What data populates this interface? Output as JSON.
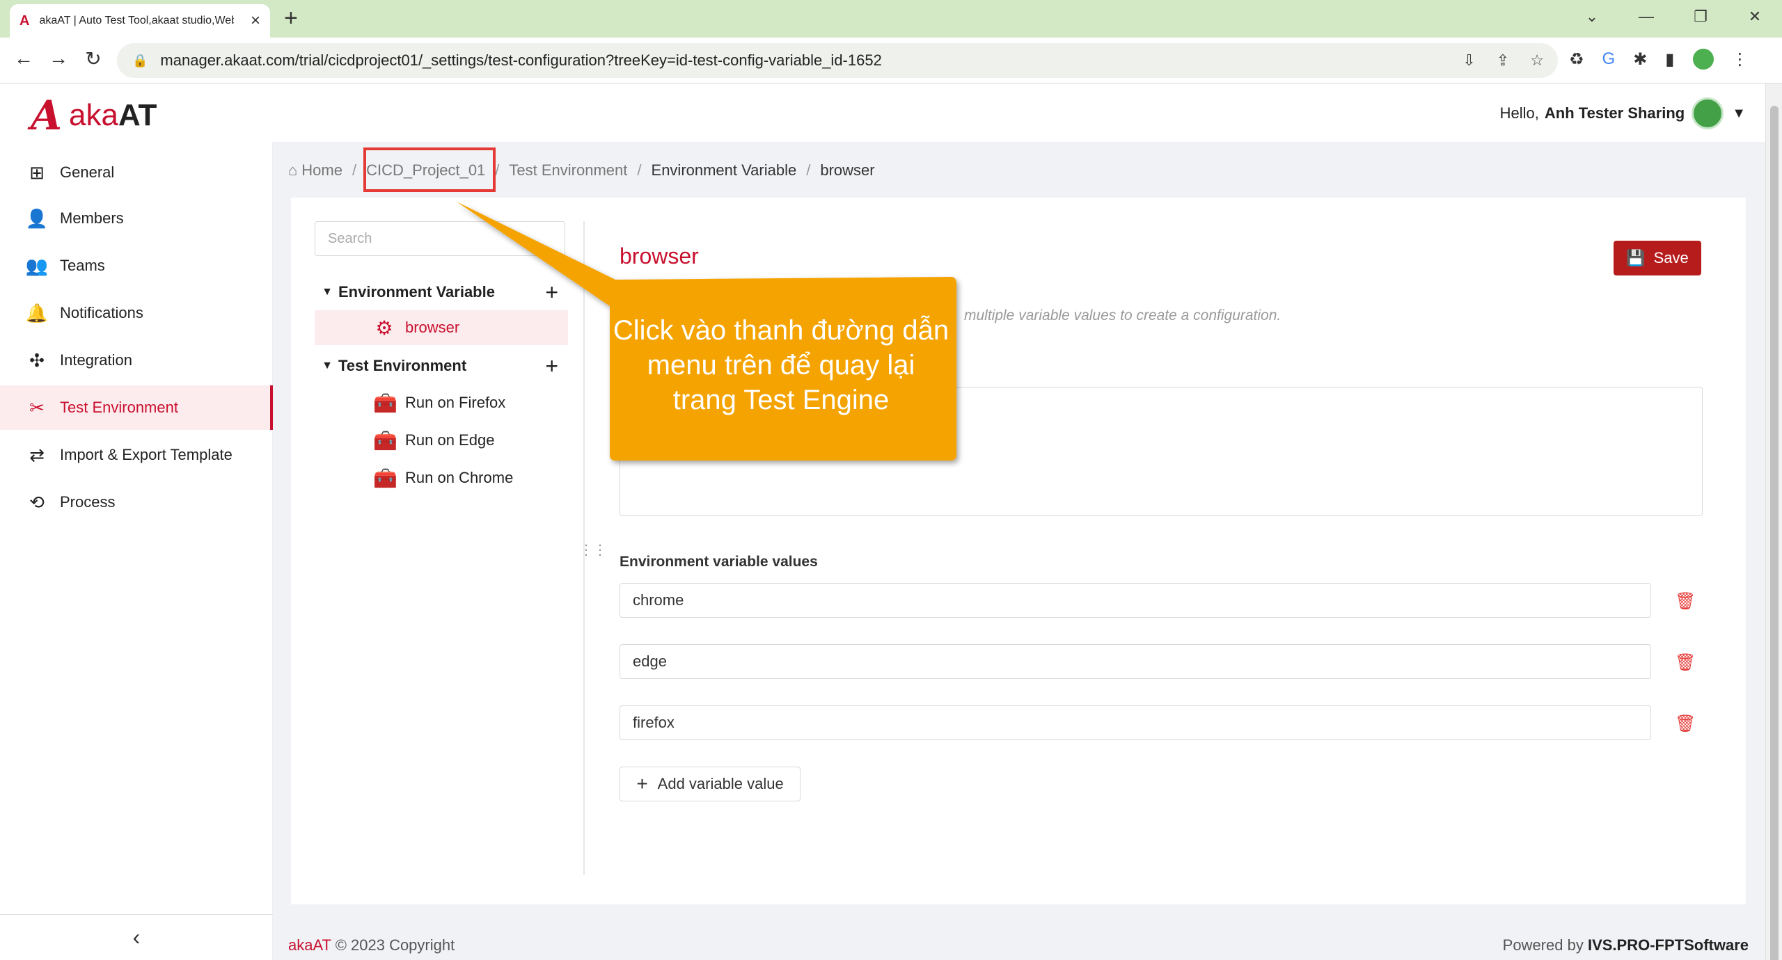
{
  "browser": {
    "tab_title": "akaAT | Auto Test Tool,akaat studio,Web",
    "url": "manager.akaat.com/trial/cicdproject01/_settings/test-configuration?treeKey=id-test-config-variable_id-1652"
  },
  "header": {
    "logo_mark": "A",
    "logo_aka": "aka",
    "logo_at": "AT",
    "greeting": "Hello,",
    "user_name": "Anh Tester Sharing"
  },
  "sidebar": {
    "items": [
      {
        "label": "General",
        "icon": "grid-icon"
      },
      {
        "label": "Members",
        "icon": "members-icon"
      },
      {
        "label": "Teams",
        "icon": "teams-icon"
      },
      {
        "label": "Notifications",
        "icon": "bell-icon"
      },
      {
        "label": "Integration",
        "icon": "integration-icon"
      },
      {
        "label": "Test Environment",
        "icon": "tools-icon",
        "active": true
      },
      {
        "label": "Import & Export Template",
        "icon": "import-export-icon"
      },
      {
        "label": "Process",
        "icon": "process-icon"
      }
    ],
    "collapse_icon": "‹"
  },
  "breadcrumb": {
    "home": "Home",
    "project": "CICD_Project_01",
    "section": "Test Environment",
    "sub": "Environment Variable",
    "current": "browser"
  },
  "tree": {
    "search_placeholder": "Search",
    "groups": [
      {
        "label": "Environment Variable",
        "items": [
          {
            "label": "browser",
            "icon": "gear-icon"
          }
        ]
      },
      {
        "label": "Test Environment",
        "items": [
          {
            "label": "Run on Firefox",
            "icon": "toolbox-icon"
          },
          {
            "label": "Run on Edge",
            "icon": "toolbox-icon"
          },
          {
            "label": "Run on Chrome",
            "icon": "toolbox-icon"
          }
        ]
      }
    ]
  },
  "detail": {
    "title": "browser",
    "save_label": "Save",
    "hint": "multiple variable values to create a configuration.",
    "values_label": "Environment variable values",
    "values": [
      "chrome",
      "edge",
      "firefox"
    ],
    "add_label": "Add variable value"
  },
  "callout": {
    "text": "Click vào thanh đường dẫn menu trên để quay lại trang Test Engine",
    "color": "#f5a300"
  },
  "footer": {
    "brand": "akaAT",
    "copyright": "© 2023 Copyright",
    "powered": "Powered by",
    "company": "IVS.PRO-FPTSoftware"
  },
  "colors": {
    "accent": "#c8102e",
    "browser_frame": "#d3e9c5"
  }
}
